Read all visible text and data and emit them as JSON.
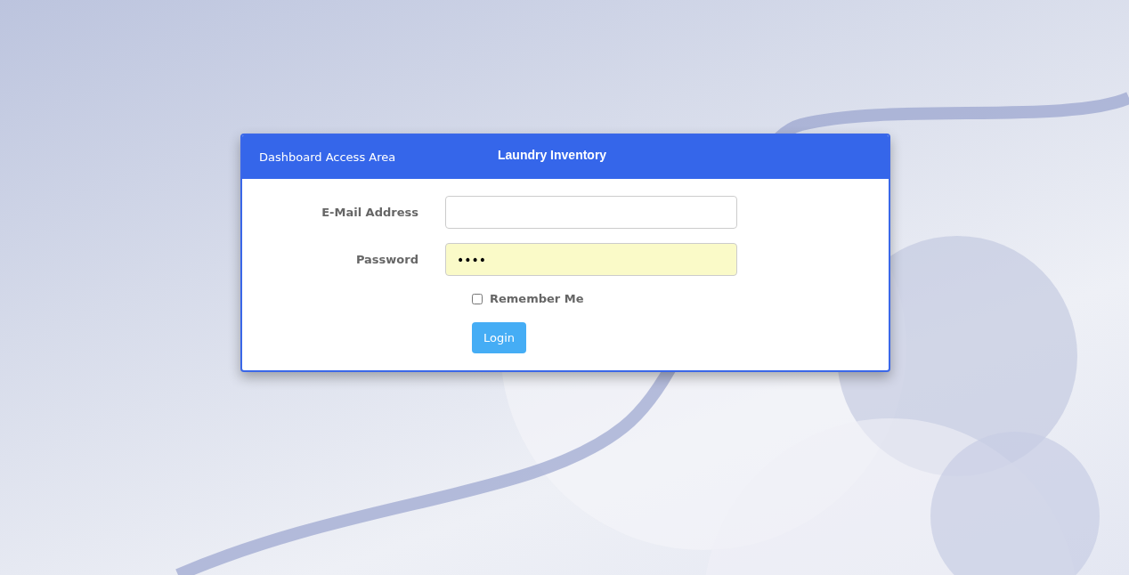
{
  "card": {
    "header_title": "Dashboard Access Area",
    "brand": "Laundry Inventory"
  },
  "fields": [
    {
      "label": "E-Mail Address",
      "autofilled": false
    },
    {
      "label": "Password",
      "value": "••••",
      "autofilled": true
    }
  ],
  "remember": {
    "label": "Remember Me",
    "checked": false
  },
  "submit": {
    "label": "Login"
  }
}
